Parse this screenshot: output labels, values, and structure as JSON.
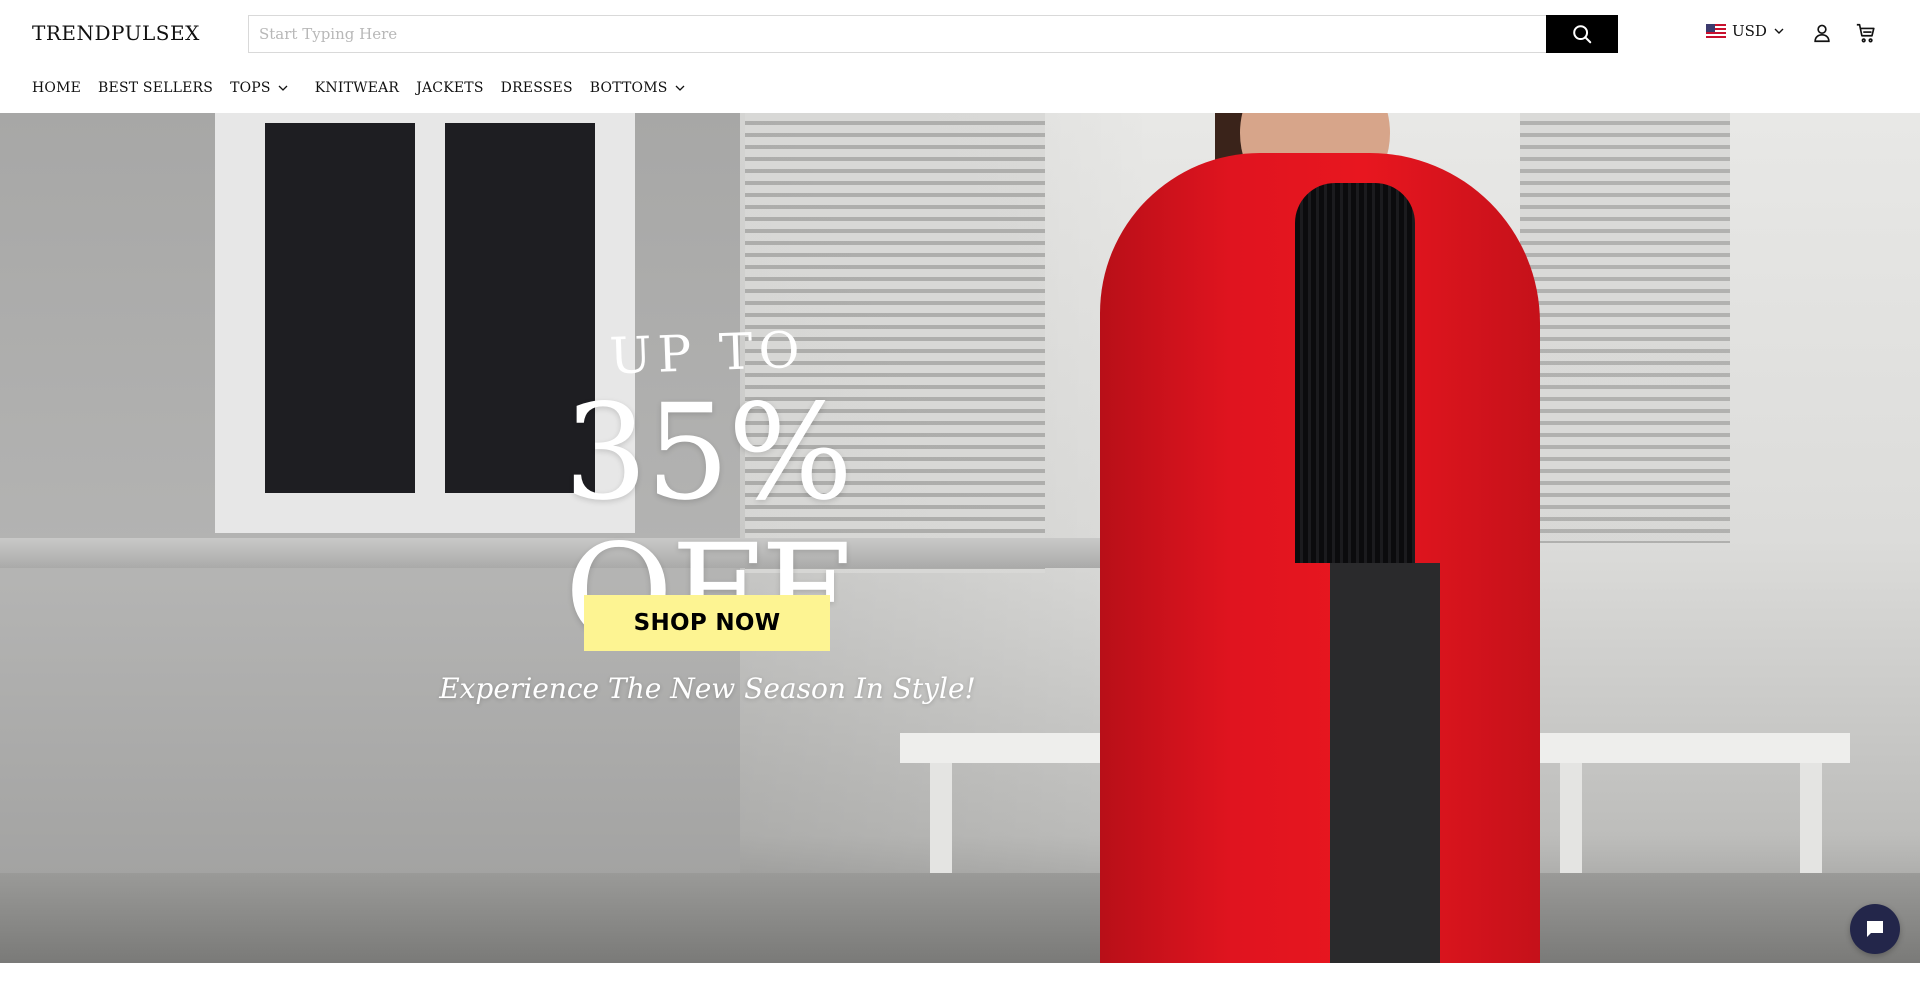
{
  "header": {
    "logo": "TRENDPULSEX",
    "search": {
      "placeholder": "Start Typing Here",
      "value": ""
    },
    "currency": {
      "label": "USD",
      "flag": "us-flag-icon"
    },
    "icons": [
      "search-icon",
      "chevron-down-icon",
      "account-icon",
      "cart-icon"
    ]
  },
  "nav": {
    "items": [
      {
        "label": "HOME",
        "dropdown": false
      },
      {
        "label": "BEST SELLERS",
        "dropdown": false
      },
      {
        "label": "TOPS",
        "dropdown": true
      },
      {
        "label": "KNITWEAR",
        "dropdown": false
      },
      {
        "label": "JACKETS",
        "dropdown": false
      },
      {
        "label": "DRESSES",
        "dropdown": false
      },
      {
        "label": "BOTTOMS",
        "dropdown": true
      }
    ]
  },
  "hero": {
    "eyebrow": "UP TO",
    "headline": "35% OFF",
    "tagline": "Experience The New Season In Style!",
    "cta": "SHOP NOW",
    "cta_color": "#fdf492",
    "coat_color": "#e0141f"
  },
  "chat": {
    "icon": "chat-bubble-icon",
    "color": "#23264a"
  }
}
